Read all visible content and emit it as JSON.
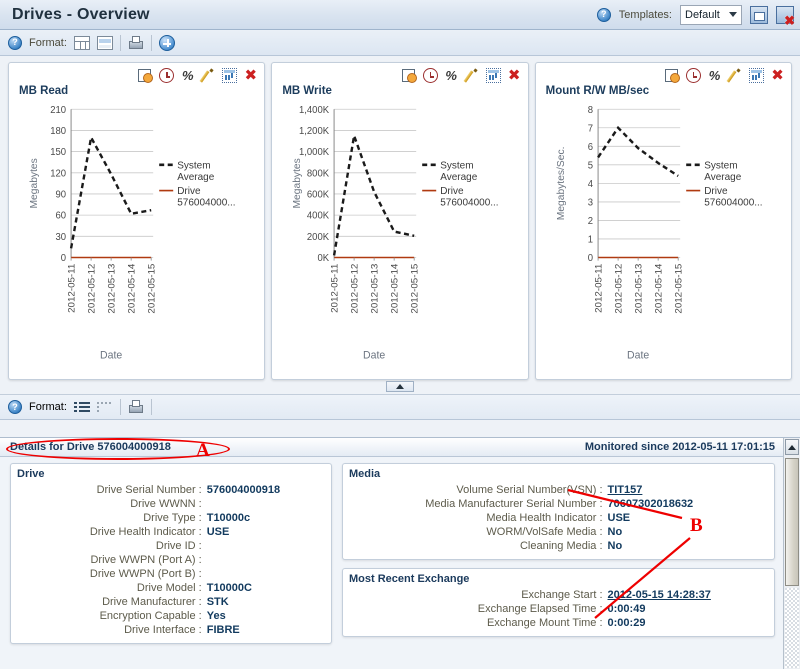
{
  "header": {
    "title": "Drives - Overview",
    "help_icon": "help-icon",
    "templates_label": "Templates:",
    "template_selected": "Default",
    "save_template_icon": "save-template-icon",
    "delete_template_icon": "delete-template-icon"
  },
  "toolbar_top": {
    "help_icon": "help-icon",
    "format_label": "Format:",
    "grid_icon": "table-format-icon",
    "pane_icon": "pane-format-icon",
    "print_icon": "print-icon",
    "add_icon": "add-graph-icon"
  },
  "toolbar_bottom": {
    "help_icon": "help-icon",
    "format_label": "Format:",
    "list_icon": "list-format-icon",
    "sparse_list_icon": "sparse-list-format-icon",
    "print_icon": "print-icon"
  },
  "chart_tools": {
    "schedule_label": "schedule-report-icon",
    "time_label": "time-range-icon",
    "percent_label": "percent-icon",
    "edit_label": "edit-icon",
    "graph_label": "export-graph-icon",
    "close_label": "close-icon",
    "close_glyph": "✖",
    "percent_glyph": "%"
  },
  "collapse": {
    "label": "collapse-panel-button"
  },
  "chart_data": [
    {
      "type": "line",
      "title": "MB Read",
      "xlabel": "Date",
      "ylabel": "Megabytes",
      "categories": [
        "2012-05-11",
        "2012-05-12",
        "2012-05-13",
        "2012-05-14",
        "2012-05-15"
      ],
      "yticks": [
        0,
        30,
        60,
        90,
        120,
        150,
        180,
        210
      ],
      "ylim": [
        0,
        210
      ],
      "grid": true,
      "legend_position": "right",
      "series": [
        {
          "name": "System Average",
          "style": "dashed",
          "color": "#1a1a1a",
          "values": [
            13,
            170,
            118,
            62,
            67
          ]
        },
        {
          "name": "Drive 576004000...",
          "style": "solid",
          "color": "#b03a10",
          "values": [
            0,
            0,
            0,
            0,
            0
          ]
        }
      ]
    },
    {
      "type": "line",
      "title": "MB Write",
      "xlabel": "Date",
      "ylabel": "Megabytes",
      "categories": [
        "2012-05-11",
        "2012-05-12",
        "2012-05-13",
        "2012-05-14",
        "2012-05-15"
      ],
      "yticks": [
        "0K",
        "200K",
        "400K",
        "600K",
        "800K",
        "1,000K",
        "1,200K",
        "1,400K"
      ],
      "ylim": [
        0,
        1400
      ],
      "grid": true,
      "legend_position": "right",
      "series": [
        {
          "name": "System Average",
          "style": "dashed",
          "color": "#1a1a1a",
          "values": [
            20,
            1150,
            620,
            245,
            205
          ]
        },
        {
          "name": "Drive 576004000...",
          "style": "solid",
          "color": "#b03a10",
          "values": [
            0,
            0,
            0,
            0,
            0
          ]
        }
      ]
    },
    {
      "type": "line",
      "title": "Mount R/W MB/sec",
      "xlabel": "Date",
      "ylabel": "Megabytes/Sec.",
      "categories": [
        "2012-05-11",
        "2012-05-12",
        "2012-05-13",
        "2012-05-14",
        "2012-05-15"
      ],
      "yticks": [
        0,
        1,
        2,
        3,
        4,
        5,
        6,
        7,
        8
      ],
      "ylim": [
        0,
        8
      ],
      "grid": true,
      "legend_position": "right",
      "series": [
        {
          "name": "System Average",
          "style": "dashed",
          "color": "#1a1a1a",
          "values": [
            5.4,
            7.0,
            5.9,
            5.1,
            4.4
          ]
        },
        {
          "name": "Drive 576004000...",
          "style": "solid",
          "color": "#b03a10",
          "values": [
            0,
            0,
            0,
            0,
            0
          ]
        }
      ]
    }
  ],
  "details": {
    "heading": "Details for Drive 576004000918",
    "monitored_since": "Monitored since 2012-05-11 17:01:15",
    "drive_group": {
      "title": "Drive",
      "rows": [
        {
          "key": "Drive Serial Number :",
          "value": "576004000918"
        },
        {
          "key": "Drive WWNN :",
          "value": ""
        },
        {
          "key": "Drive Type :",
          "value": "T10000c"
        },
        {
          "key": "Drive Health Indicator :",
          "value": "USE"
        },
        {
          "key": "Drive ID :",
          "value": ""
        },
        {
          "key": "Drive WWPN (Port A) :",
          "value": ""
        },
        {
          "key": "Drive WWPN (Port B) :",
          "value": ""
        },
        {
          "key": "Drive Model :",
          "value": "T10000C"
        },
        {
          "key": "Drive Manufacturer :",
          "value": "STK"
        },
        {
          "key": "Encryption Capable :",
          "value": "Yes"
        },
        {
          "key": "Drive Interface :",
          "value": "FIBRE"
        }
      ]
    },
    "media_group": {
      "title": "Media",
      "rows": [
        {
          "key": "Volume Serial Number(VSN) :",
          "value": "TIT157",
          "link": true
        },
        {
          "key": "Media Manufacturer Serial Number :",
          "value": "70607302018632"
        },
        {
          "key": "Media Health Indicator :",
          "value": "USE"
        },
        {
          "key": "WORM/VolSafe Media :",
          "value": "No"
        },
        {
          "key": "Cleaning Media :",
          "value": "No"
        }
      ]
    },
    "exchange_group": {
      "title": "Most Recent Exchange",
      "rows": [
        {
          "key": "Exchange Start :",
          "value": "2012-05-15 14:28:37",
          "link": true
        },
        {
          "key": "Exchange Elapsed Time :",
          "value": "0:00:49"
        },
        {
          "key": "Exchange Mount Time :",
          "value": "0:00:29"
        }
      ]
    }
  },
  "annotations": [
    {
      "label": "A"
    },
    {
      "label": "B"
    }
  ],
  "colors": {
    "accent": "#123a5e",
    "annotation": "#ee0000",
    "series_system": "#1a1a1a",
    "series_drive": "#b03a10"
  }
}
